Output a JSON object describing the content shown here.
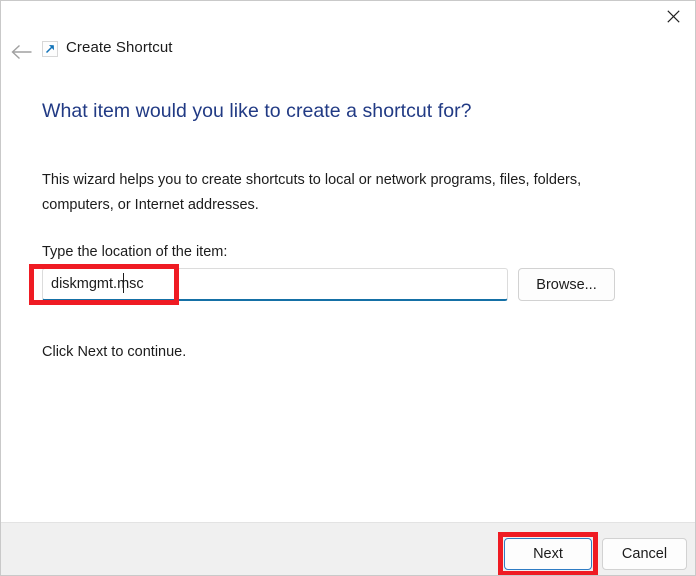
{
  "window": {
    "title": "Create Shortcut",
    "icon": "shortcut-arrow-icon",
    "close_label": "✕",
    "back_label": "←"
  },
  "content": {
    "heading": "What item would you like to create a shortcut for?",
    "paragraph": "This wizard helps you to create shortcuts to local or network programs, files, folders, computers, or Internet addresses.",
    "field_label": "Type the location of the item:",
    "input_value": "diskmgmt.msc",
    "input_placeholder": "",
    "browse_label": "Browse...",
    "hint": "Click Next to continue."
  },
  "footer": {
    "next_label": "Next",
    "cancel_label": "Cancel"
  },
  "colors": {
    "heading_blue": "#213a84",
    "accent_blue": "#1570a6",
    "default_button_border": "#2f7cc4",
    "annotation_red": "#ef1b23",
    "footer_bg": "#f0f0f0"
  }
}
